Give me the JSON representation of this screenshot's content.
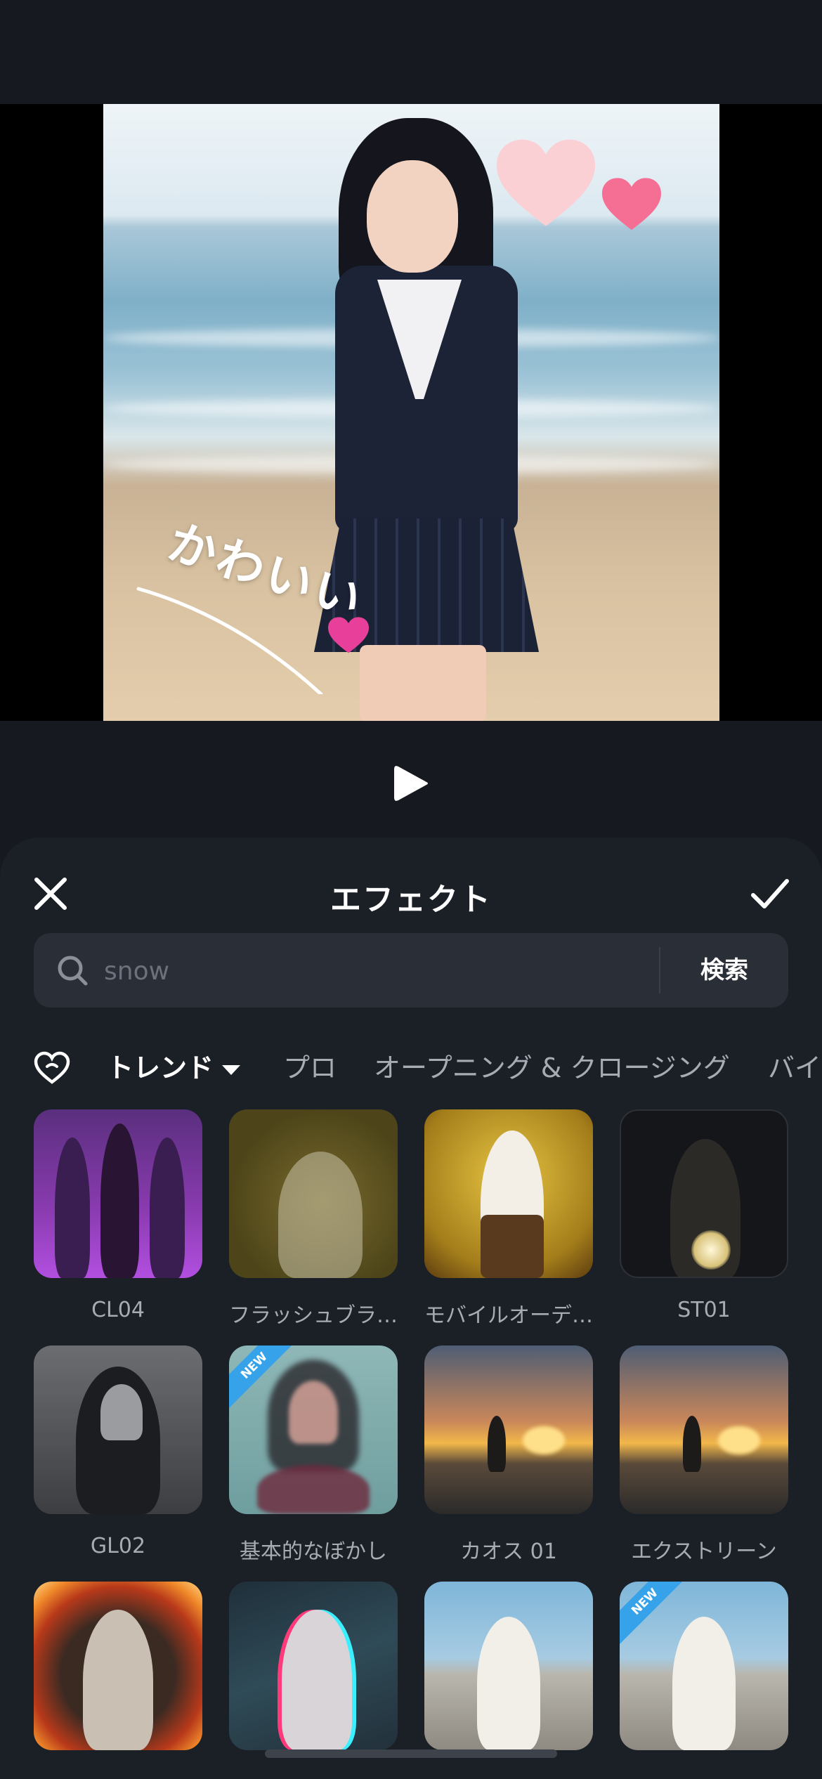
{
  "preview": {
    "sticker_text": "かわいい"
  },
  "sheet": {
    "title": "エフェクト",
    "search": {
      "placeholder": "snow",
      "button_label": "検索"
    },
    "tabs": [
      {
        "label": "トレンド",
        "active": true
      },
      {
        "label": "プロ",
        "active": false
      },
      {
        "label": "オープニング & クロージング",
        "active": false
      },
      {
        "label": "バイ",
        "active": false
      }
    ],
    "effects": [
      {
        "label": "CL04",
        "icon": "dancers-purple-thumb",
        "new": false
      },
      {
        "label": "フラッシュブラ…",
        "icon": "hair-flash-thumb",
        "new": false
      },
      {
        "label": "モバイルオーデ…",
        "icon": "dancer-yellow-thumb",
        "new": false
      },
      {
        "label": "ST01",
        "icon": "dark-candle-thumb",
        "new": false
      },
      {
        "label": "GL02",
        "icon": "bw-portrait-thumb",
        "new": false
      },
      {
        "label": "基本的なぼかし",
        "icon": "blur-portrait-thumb",
        "new": true
      },
      {
        "label": "カオス 01",
        "icon": "sunset-surfer-thumb",
        "new": false
      },
      {
        "label": "エクストリーン",
        "icon": "sunset-surfer-thumb",
        "new": false
      },
      {
        "label": "",
        "icon": "fire-frame-thumb",
        "new": false
      },
      {
        "label": "",
        "icon": "rgb-glitch-thumb",
        "new": false
      },
      {
        "label": "",
        "icon": "skater-thumb",
        "new": false
      },
      {
        "label": "",
        "icon": "skater-thumb",
        "new": true
      }
    ],
    "new_badge_text": "NEW"
  },
  "colors": {
    "background": "#16191f",
    "sheet": "#1b1f26",
    "search_bar": "#2a2e36",
    "new_badge": "#35a2ea"
  }
}
